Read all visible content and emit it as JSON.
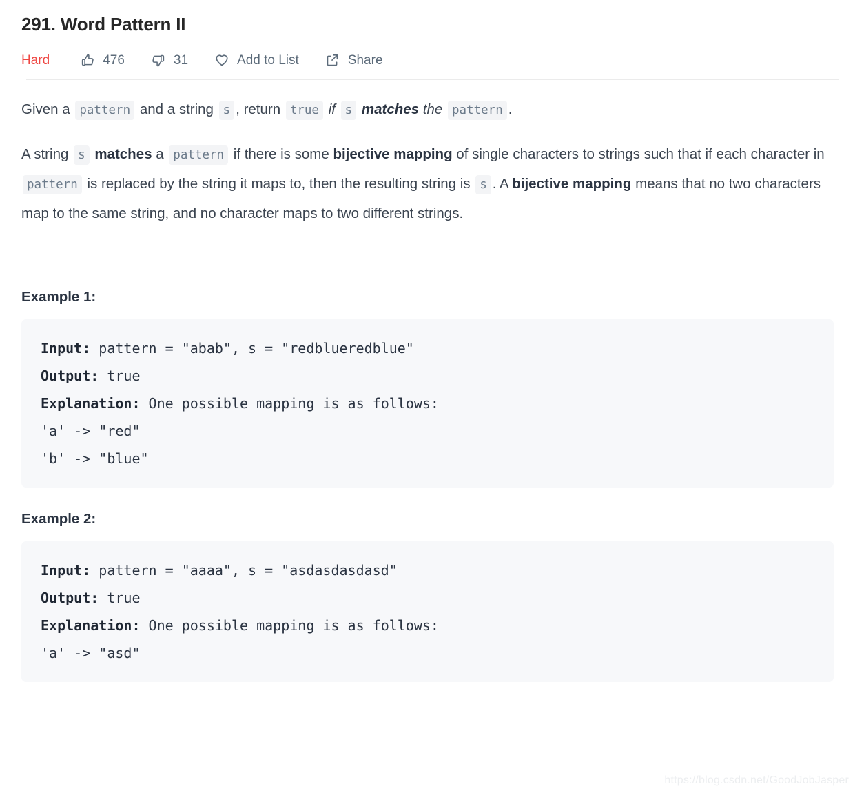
{
  "problem": {
    "title": "291. Word Pattern II",
    "difficulty": "Hard",
    "difficulty_color": "#ef4743"
  },
  "meta": {
    "likes_icon": "thumbs-up-icon",
    "likes": "476",
    "dislikes_icon": "thumbs-down-icon",
    "dislikes": "31",
    "add_to_list_icon": "heart-icon",
    "add_to_list_label": "Add to List",
    "share_icon": "share-icon",
    "share_label": "Share"
  },
  "description": {
    "p1": {
      "t1": "Given a ",
      "c1": "pattern",
      "t2": " and a string ",
      "c2": "s",
      "t3": ", return ",
      "c3": "true",
      "t4": " ",
      "i1": "if",
      "t5": " ",
      "c4": "s",
      "t6": " ",
      "bi1": "matches",
      "t7": " ",
      "i2": "the",
      "t8": " ",
      "c5": "pattern",
      "t9": "."
    },
    "p2": {
      "t1": "A string ",
      "c1": "s",
      "t2": " ",
      "b1": "matches",
      "t3": " a ",
      "c2": "pattern",
      "t4": " if there is some ",
      "b2": "bijective mapping",
      "t5": " of single characters to strings such that if each character in ",
      "c3": "pattern",
      "t6": " is replaced by the string it maps to, then the resulting string is ",
      "c4": "s",
      "t7": ". A ",
      "b3": "bijective mapping",
      "t8": " means that no two characters map to the same string, and no character maps to two different strings."
    }
  },
  "examples": [
    {
      "heading": "Example 1:",
      "input_label": "Input:",
      "input_value": " pattern = \"abab\", s = \"redblueredblue\"",
      "output_label": "Output:",
      "output_value": " true",
      "explanation_label": "Explanation:",
      "explanation_value": " One possible mapping is as follows:",
      "mappings": [
        "'a' -> \"red\"",
        "'b' -> \"blue\""
      ]
    },
    {
      "heading": "Example 2:",
      "input_label": "Input:",
      "input_value": " pattern = \"aaaa\", s = \"asdasdasdasd\"",
      "output_label": "Output:",
      "output_value": " true",
      "explanation_label": "Explanation:",
      "explanation_value": " One possible mapping is as follows:",
      "mappings": [
        "'a' -> \"asd\""
      ]
    }
  ],
  "watermark": "https://blog.csdn.net/GoodJobJasper"
}
